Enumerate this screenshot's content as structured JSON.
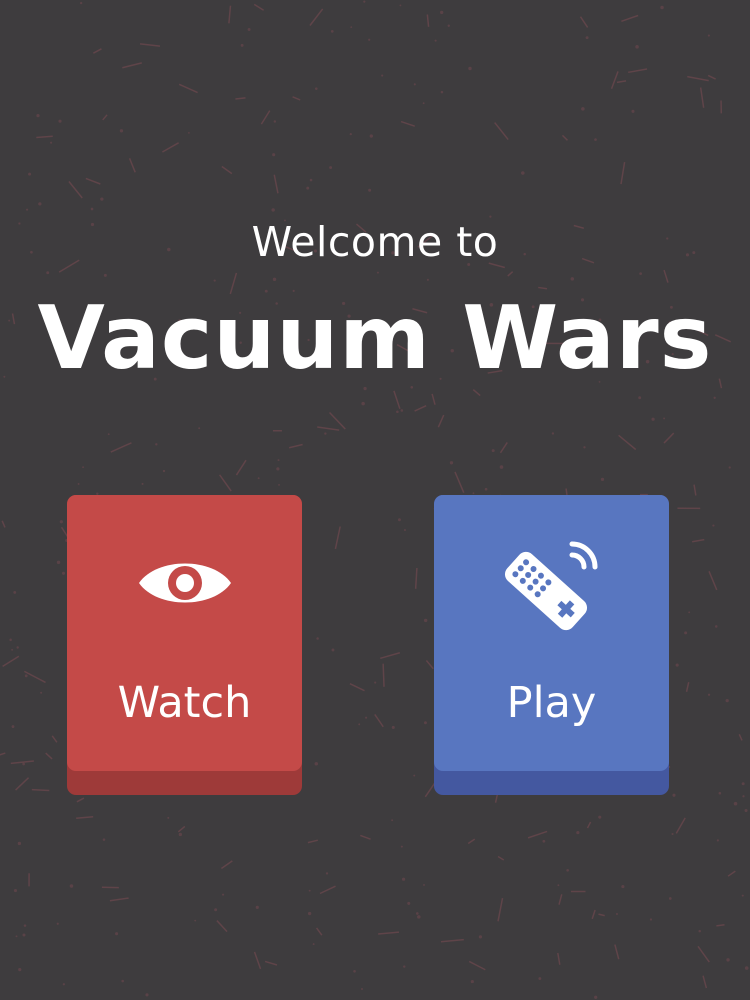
{
  "header": {
    "welcome_text": "Welcome to",
    "game_title": "Vacuum Wars"
  },
  "modes": [
    {
      "label": "Watch",
      "icon": "eye-icon",
      "color": "#c44a48",
      "shadow_color": "#9e3a39"
    },
    {
      "label": "Play",
      "icon": "remote-control-icon",
      "color": "#5876c0",
      "shadow_color": "#4458a0"
    }
  ],
  "theme": {
    "background": "#3e3c3e",
    "speck_color": "#7a4a52",
    "text_color": "#ffffff"
  }
}
